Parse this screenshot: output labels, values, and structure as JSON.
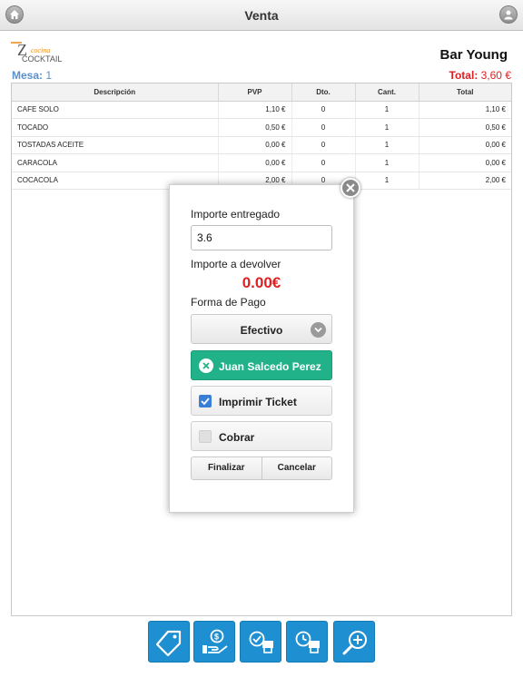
{
  "header": {
    "title": "Venta",
    "home_icon": "home-icon",
    "user_icon": "user-icon"
  },
  "brand": {
    "logo_top": "Z",
    "logo_script": "cocina",
    "logo_word": "COCKTAIL",
    "shop_name": "Bar Young"
  },
  "summary": {
    "mesa_label": "Mesa:",
    "mesa_value": "1",
    "total_label": "Total:",
    "total_value": "3,60 €"
  },
  "table": {
    "columns": [
      "Descripción",
      "PVP",
      "Dto.",
      "Cant.",
      "Total"
    ],
    "rows": [
      {
        "desc": "CAFE SOLO",
        "pvp": "1,10 €",
        "dto": "0",
        "cant": "1",
        "total": "1,10 €"
      },
      {
        "desc": "TOCADO",
        "pvp": "0,50 €",
        "dto": "0",
        "cant": "1",
        "total": "0,50 €"
      },
      {
        "desc": "TOSTADAS ACEITE",
        "pvp": "0,00 €",
        "dto": "0",
        "cant": "1",
        "total": "0,00 €"
      },
      {
        "desc": "CARACOLA",
        "pvp": "0,00 €",
        "dto": "0",
        "cant": "1",
        "total": "0,00 €"
      },
      {
        "desc": "COCACOLA",
        "pvp": "2,00 €",
        "dto": "0",
        "cant": "1",
        "total": "2,00 €"
      }
    ]
  },
  "modal": {
    "importe_label": "Importe entregado",
    "importe_value": "3.6",
    "devolver_label": "Importe a devolver",
    "devolver_value": "0.00€",
    "forma_label": "Forma de Pago",
    "forma_value": "Efectivo",
    "client_name": "Juan Salcedo Perez",
    "imprimir_label": "Imprimir Ticket",
    "imprimir_checked": true,
    "cobrar_label": "Cobrar",
    "cobrar_checked": false,
    "finalizar_label": "Finalizar",
    "cancelar_label": "Cancelar"
  },
  "toolbar": {
    "icons": [
      "price-tag-icon",
      "payment-icon",
      "check-ticket-icon",
      "clock-ticket-icon",
      "zoom-in-icon"
    ]
  },
  "colors": {
    "accent_blue": "#1e8fd1",
    "total_red": "#e02020",
    "client_green": "#21b28a",
    "mesa_blue": "#5b8fd0"
  }
}
